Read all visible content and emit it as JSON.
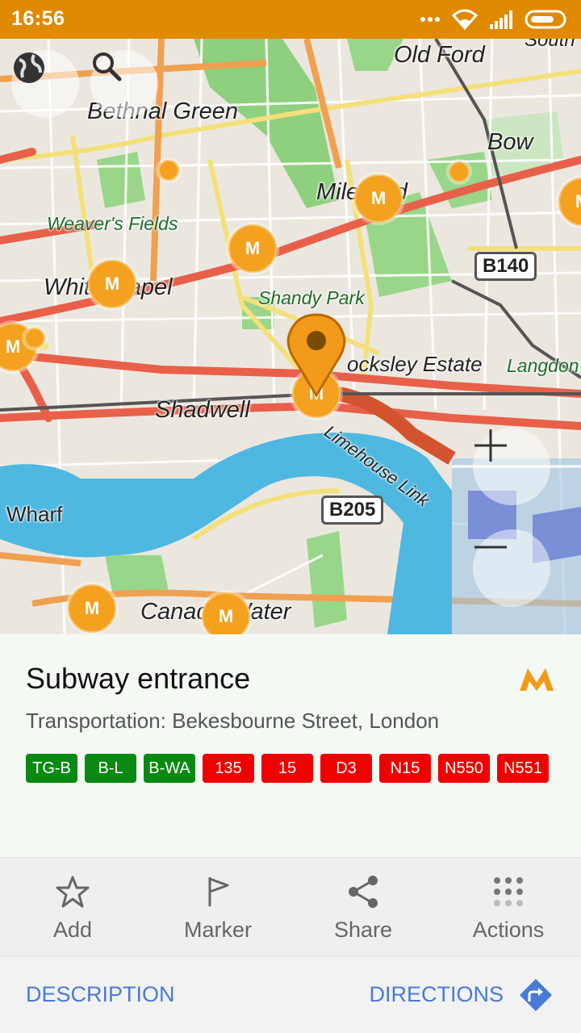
{
  "status": {
    "time": "16:56"
  },
  "map": {
    "labels": {
      "old_ford": "Old Ford",
      "south": "South",
      "bethnal_green": "Bethnal Green",
      "bow": "Bow",
      "mile_end": "Mile End",
      "weavers_fields": "Weaver's Fields",
      "whitechapel": "Whitechapel",
      "shandy_park": "Shandy Park",
      "locksley_estate": "ocksley Estate",
      "langdon": "Langdon",
      "shadwell": "Shadwell",
      "limehouse_link": "Limehouse Link",
      "wharf": "Wharf",
      "canada_water": "Canada Water"
    },
    "shields": {
      "b140": "B140",
      "b205": "B205"
    },
    "metro_glyph": "M"
  },
  "poi": {
    "title": "Subway entrance",
    "subtitle": "Transportation: Bekesbourne Street, London",
    "routes": [
      {
        "label": "TG-B",
        "color": "#0a8a12"
      },
      {
        "label": "B-L",
        "color": "#0a8a12"
      },
      {
        "label": "B-WA",
        "color": "#0a8a12"
      },
      {
        "label": "135",
        "color": "#f00000"
      },
      {
        "label": "15",
        "color": "#f00000"
      },
      {
        "label": "D3",
        "color": "#f00000"
      },
      {
        "label": "N15",
        "color": "#f00000"
      },
      {
        "label": "N550",
        "color": "#f00000"
      },
      {
        "label": "N551",
        "color": "#f00000"
      }
    ]
  },
  "actions": {
    "add": "Add",
    "marker": "Marker",
    "share": "Share",
    "more": "Actions"
  },
  "bottom": {
    "description": "DESCRIPTION",
    "directions": "DIRECTIONS"
  },
  "colors": {
    "accent": "#e08a00",
    "link": "#4a7ad8",
    "metro": "#f3a11f"
  }
}
